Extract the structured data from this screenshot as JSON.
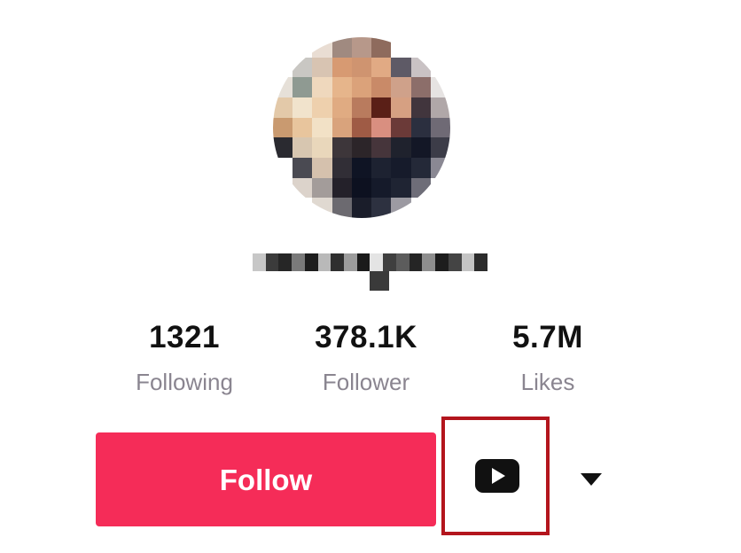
{
  "stats": {
    "following": {
      "value": "1321",
      "label": "Following"
    },
    "followers": {
      "value": "378.1K",
      "label": "Follower"
    },
    "likes": {
      "value": "5.7M",
      "label": "Likes"
    }
  },
  "actions": {
    "follow_label": "Follow",
    "video_icon": "youtube-play-icon",
    "dropdown_icon": "triangle-down-icon"
  },
  "colors": {
    "follow_button": "#f52c58",
    "highlight_box": "#b3151d",
    "stat_value": "#111111",
    "stat_label": "#8a8590"
  }
}
